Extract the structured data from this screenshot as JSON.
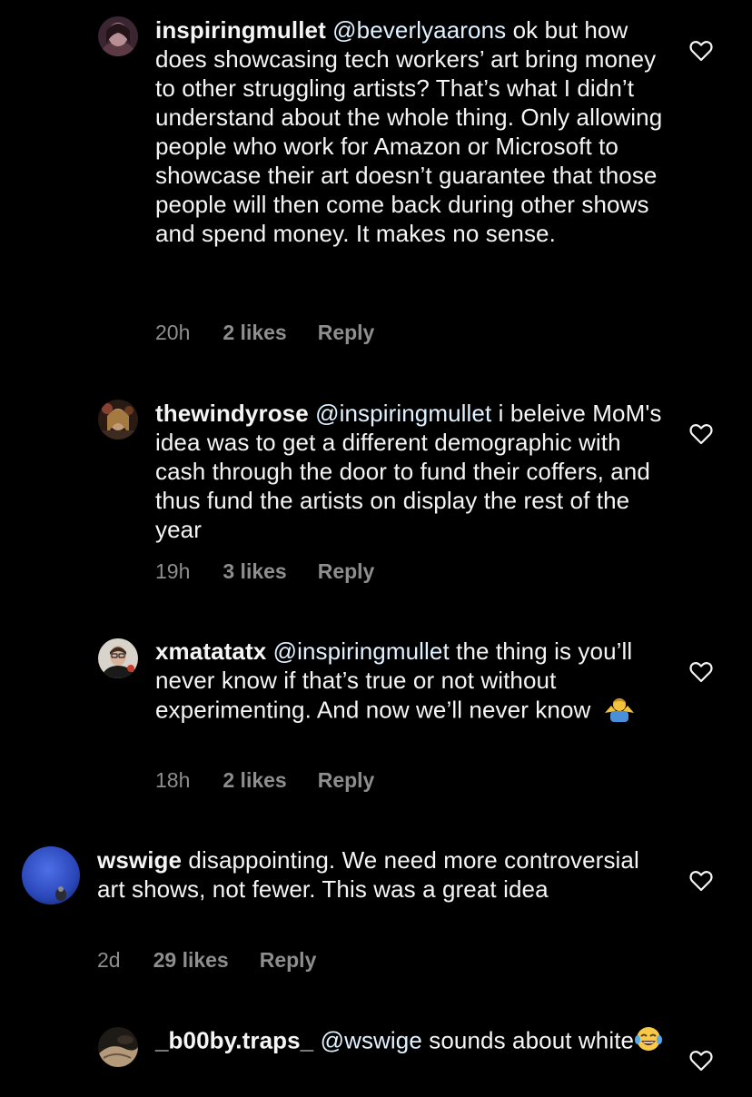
{
  "comments": [
    {
      "username": "inspiringmullet",
      "mention": "@beverlyaarons",
      "body": " ok but how does showcasing tech workers’ art bring money to other struggling artists? That’s what I didn’t understand about the whole thing. Only allowing people who work for Amazon or Microsoft to showcase their art doesn’t guarantee that those people will then come back during other shows and spend money. It makes no sense.",
      "time": "20h",
      "likes": "2 likes",
      "reply": "Reply"
    },
    {
      "username": "thewindyrose",
      "mention": "@inspiringmullet",
      "body": "  i beleive MoM's idea was to get a different demographic with cash through the door to fund their coffers, and thus fund the artists on display the rest of the year",
      "time": "19h",
      "likes": "3 likes",
      "reply": "Reply"
    },
    {
      "username": "xmatatatx",
      "mention": "@inspiringmullet",
      "body": " the thing is you’ll never know if that’s true or not without experimenting. And now we’ll never know",
      "emoji": "person-shrugging-emoji",
      "time": "18h",
      "likes": "2 likes",
      "reply": "Reply"
    },
    {
      "username": "wswige",
      "mention": "",
      "body": " disappointing. We need more controversial art shows, not fewer. This was a great idea",
      "time": "2d",
      "likes": "29 likes",
      "reply": "Reply"
    },
    {
      "username": "_b00by.traps_",
      "mention": "@wswige",
      "body": " sounds about white",
      "emoji": "tears-of-joy-emoji"
    }
  ],
  "colors": {
    "background": "#000000",
    "text": "#f5f5f5",
    "meta": "#8e8e8e",
    "mention": "#e0f1ff"
  }
}
